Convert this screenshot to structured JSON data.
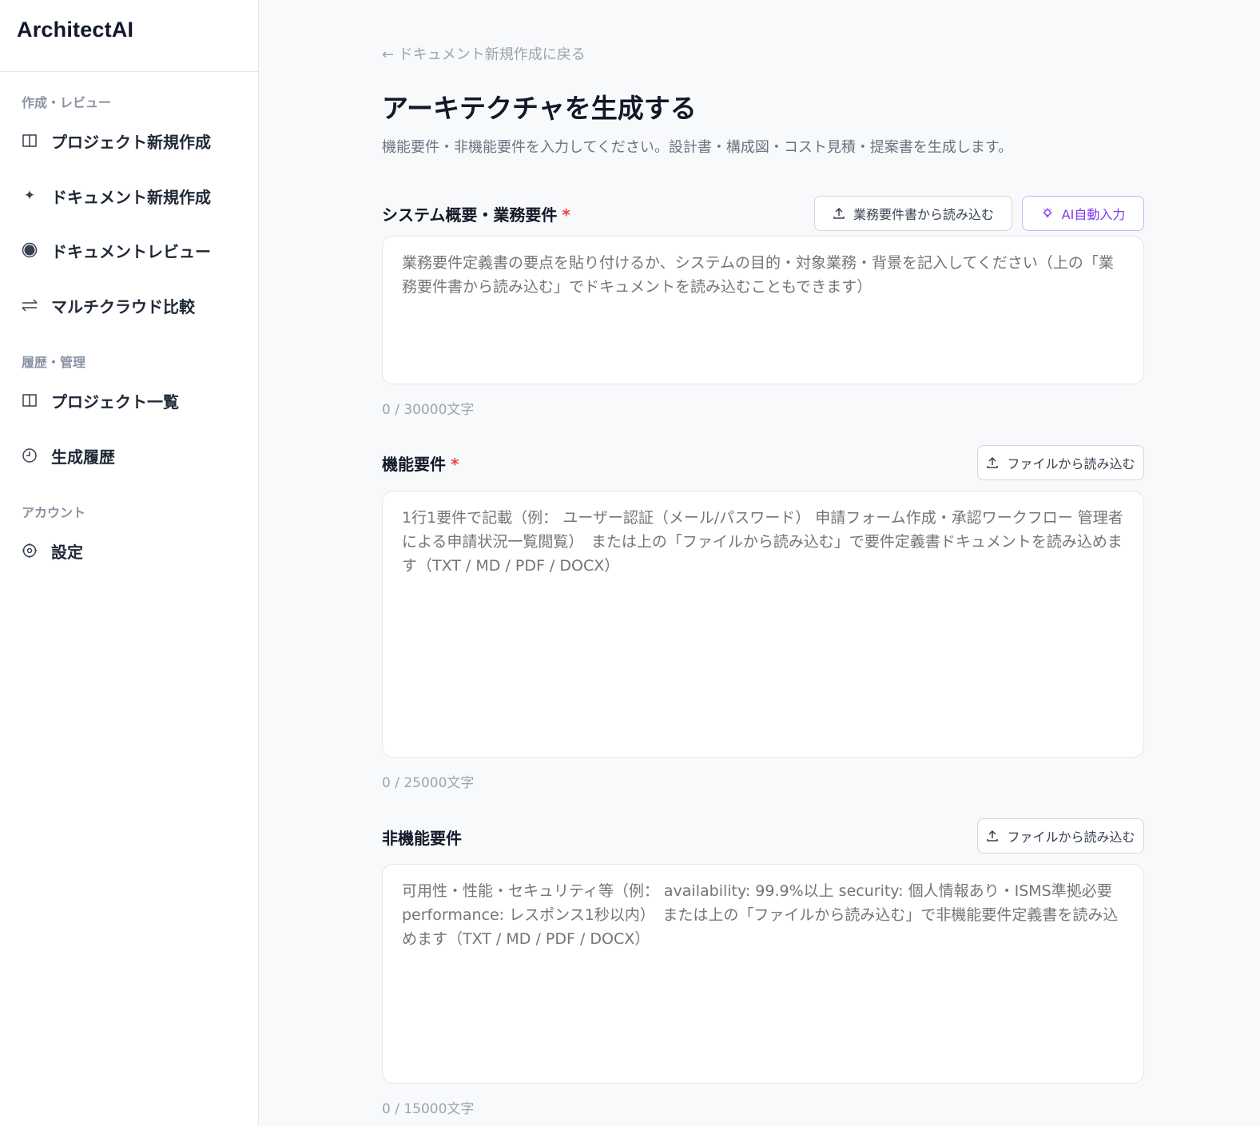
{
  "app": {
    "title": "ArchitectAI"
  },
  "sidebar": {
    "sections": [
      {
        "label": "作成・レビュー",
        "items": [
          {
            "label": "プロジェクト新規作成",
            "icon": "panel-icon"
          },
          {
            "label": "ドキュメント新規作成",
            "icon": "sparkle-icon"
          },
          {
            "label": "ドキュメントレビュー",
            "icon": "record-icon"
          },
          {
            "label": "マルチクラウド比較",
            "icon": "swap-icon"
          }
        ]
      },
      {
        "label": "履歴・管理",
        "items": [
          {
            "label": "プロジェクト一覧",
            "icon": "panel-icon"
          },
          {
            "label": "生成履歴",
            "icon": "clock-icon"
          }
        ]
      },
      {
        "label": "アカウント",
        "items": [
          {
            "label": "設定",
            "icon": "gear-icon"
          }
        ]
      }
    ]
  },
  "main": {
    "back_link": "← ドキュメント新規作成に戻る",
    "title": "アーキテクチャを生成する",
    "subtitle": "機能要件・非機能要件を入力してください。設計書・構成図・コスト見積・提案書を生成します。",
    "fields": {
      "system": {
        "label": "システム概要・業務要件",
        "required_mark": "*",
        "import_button": "業務要件書から読み込む",
        "ai_button": "AI自動入力",
        "placeholder": "業務要件定義書の要点を貼り付けるか、システムの目的・対象業務・背景を記入してください（上の「業務要件書から読み込む」でドキュメントを読み込むこともできます）",
        "counter": "0 / 30000文字"
      },
      "functional": {
        "label": "機能要件",
        "required_mark": "*",
        "import_button": "ファイルから読み込む",
        "placeholder": "1行1要件で記載（例： ユーザー認証（メール/パスワード） 申請フォーム作成・承認ワークフロー 管理者による申請状況一覧閲覧）　または上の「ファイルから読み込む」で要件定義書ドキュメントを読み込めます（TXT / MD / PDF / DOCX）",
        "counter": "0 / 25000文字"
      },
      "nonfunctional": {
        "label": "非機能要件",
        "import_button": "ファイルから読み込む",
        "placeholder": "可用性・性能・セキュリティ等（例： availability: 99.9%以上 security: 個人情報あり・ISMS準拠必要 performance: レスポンス1秒以内）　または上の「ファイルから読み込む」で非機能要件定義書を読み込めます（TXT / MD / PDF / DOCX）",
        "counter": "0 / 15000文字"
      }
    }
  },
  "colors": {
    "accent_ai": "#7c3aed",
    "required": "#ef4444",
    "muted": "#9ca3af"
  }
}
